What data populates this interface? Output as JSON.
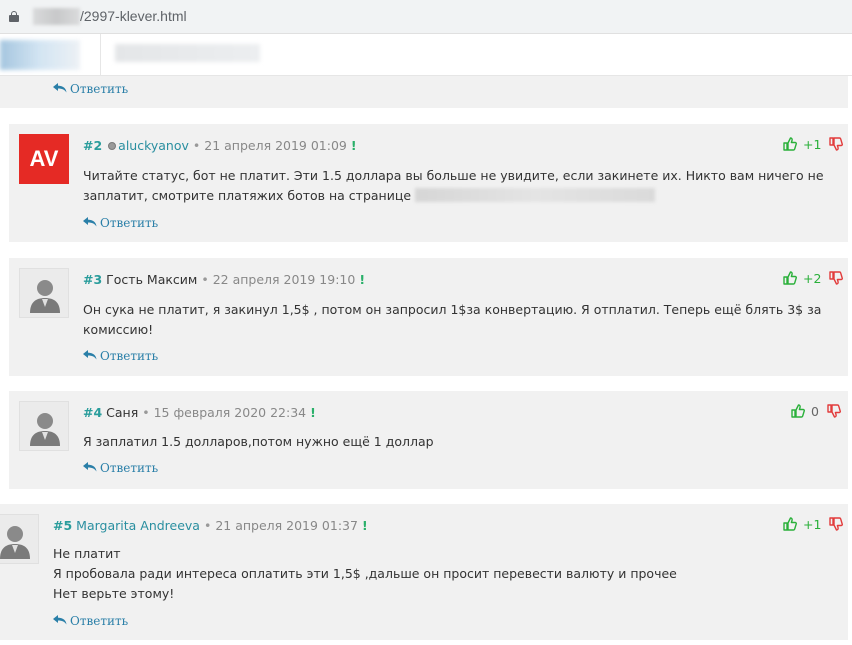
{
  "browser": {
    "url_path": "/2997-klever.html"
  },
  "reply_label": "Ответить",
  "comments": [
    {
      "number": "#2",
      "author": "aluckyanov",
      "date": "21 апреля 2019 01:09",
      "avatar_text": "AV",
      "text_lines": [
        "Читайте статус, бот не платит. Эти 1.5 доллара вы больше не увидите, если закинете их. Никто вам ничего не",
        "заплатит, смотрите платяжих ботов на странице"
      ],
      "score": "+1"
    },
    {
      "number": "#3",
      "author": "Гость Максим",
      "date": "22 апреля 2019 19:10",
      "text_lines": [
        "Он сука не платит, я закинул 1,5$ , потом он запросил 1$за конвертацию. Я отплатил. Теперь ещё блять 3$ за",
        "комиссию!"
      ],
      "score": "+2"
    },
    {
      "number": "#4",
      "author": "Саня",
      "date": "15 февраля 2020 22:34",
      "text_lines": [
        "Я заплатил 1.5 долларов,потом нужно ещё 1 доллар"
      ],
      "score": "0"
    },
    {
      "number": "#5",
      "author": "Margarita Andreeva",
      "date": "21 апреля 2019 01:37",
      "text_lines": [
        "Не платит",
        "Я пробовала ради интереса оплатить эти 1,5$ ,дальше он просит перевести валюту и прочее",
        "Нет верьте этому!"
      ],
      "score": "+1"
    }
  ],
  "colors": {
    "accent": "#2a9d9c",
    "link": "#2a7fa8",
    "vote_up": "#2ab03a",
    "vote_down": "#e23b3b",
    "avatar_av": "#e52a25"
  },
  "icons": {
    "lock": "lock-icon",
    "reply": "reply-arrow-icon",
    "thumb_up": "thumbs-up-icon",
    "thumb_down": "thumbs-down-icon",
    "status": "status-dot-icon",
    "avatar_default": "user-avatar-icon"
  }
}
